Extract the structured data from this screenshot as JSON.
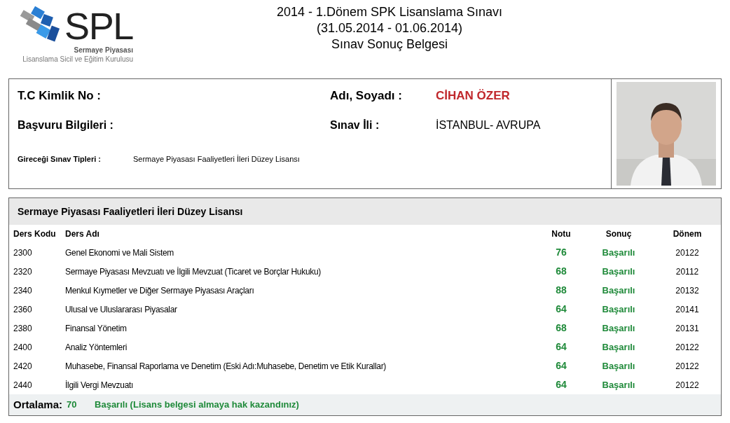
{
  "logo": {
    "wordmark": "SPL",
    "line_1": "Sermaye Piyasası",
    "line_2": "Lisanslama Sicil ve Eğitim Kurulusu"
  },
  "title": {
    "line_1": "2014 - 1.Dönem SPK Lisanslama Sınavı",
    "line_2": "(31.05.2014 - 01.06.2014)",
    "line_3": "Sınav Sonuç Belgesi"
  },
  "info": {
    "id_label": "T.C Kimlik No :",
    "name_label": "Adı, Soyadı :",
    "name_value": "CİHAN ÖZER",
    "application_label": "Başvuru Bilgileri :",
    "city_label": "Sınav İli :",
    "city_value": "İSTANBUL- AVRUPA",
    "exam_types_label": "Gireceği Sınav Tipleri :",
    "exam_types_value": "Sermaye Piyasası Faaliyetleri İleri Düzey Lisansı"
  },
  "results": {
    "title": "Sermaye Piyasası Faaliyetleri İleri Düzey Lisansı",
    "columns": [
      "Ders Kodu",
      "Ders Adı",
      "Notu",
      "Sonuç",
      "Dönem"
    ],
    "rows": [
      {
        "code": "2300",
        "name": "Genel Ekonomi ve Mali Sistem",
        "grade": "76",
        "result": "Başarılı",
        "term": "20122"
      },
      {
        "code": "2320",
        "name": "Sermaye Piyasası Mevzuatı ve İlgili Mevzuat (Ticaret ve Borçlar Hukuku)",
        "grade": "68",
        "result": "Başarılı",
        "term": "20112"
      },
      {
        "code": "2340",
        "name": "Menkul Kıymetler ve Diğer Sermaye Piyasası Araçları",
        "grade": "88",
        "result": "Başarılı",
        "term": "20132"
      },
      {
        "code": "2360",
        "name": "Ulusal ve Uluslararası Piyasalar",
        "grade": "64",
        "result": "Başarılı",
        "term": "20141"
      },
      {
        "code": "2380",
        "name": "Finansal Yönetim",
        "grade": "68",
        "result": "Başarılı",
        "term": "20131"
      },
      {
        "code": "2400",
        "name": "Analiz Yöntemleri",
        "grade": "64",
        "result": "Başarılı",
        "term": "20122"
      },
      {
        "code": "2420",
        "name": "Muhasebe, Finansal Raporlama ve Denetim (Eski Adı:Muhasebe, Denetim ve Etik Kurallar)",
        "grade": "64",
        "result": "Başarılı",
        "term": "20122"
      },
      {
        "code": "2440",
        "name": "İlgili Vergi Mevzuatı",
        "grade": "64",
        "result": "Başarılı",
        "term": "20122"
      }
    ],
    "average_label": "Ortalama:",
    "average_value": "70",
    "average_result": "Başarılı (Lisans belgesi almaya hak kazandınız)"
  }
}
